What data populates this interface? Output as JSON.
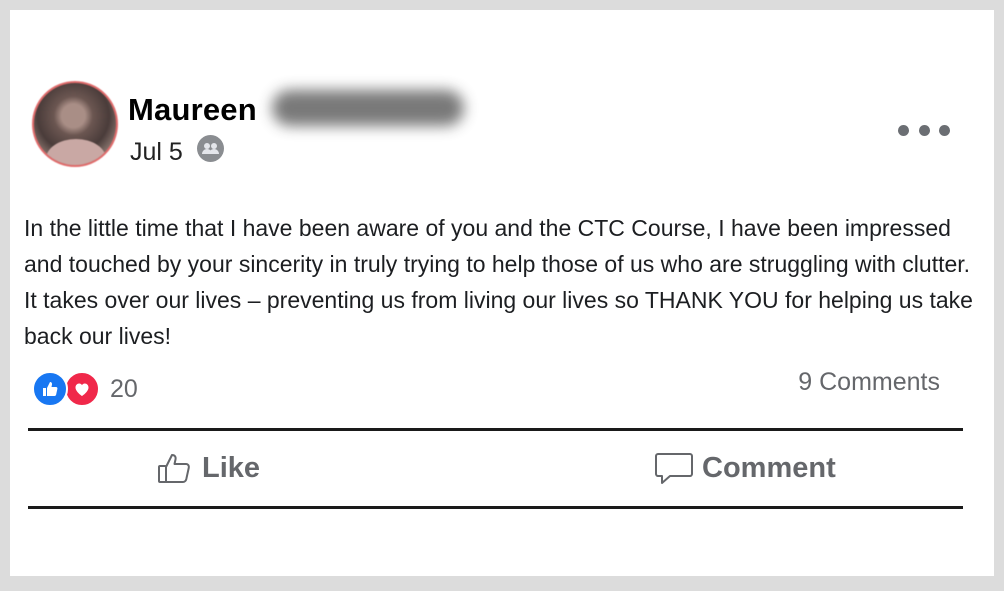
{
  "post": {
    "author_first_name": "Maureen",
    "date": "Jul 5",
    "audience_icon": "friends-icon",
    "body": "In the little time that I have been aware of you and the CTC Course, I have been impressed and touched by your sincerity in truly trying to help those of us who are struggling with clutter. It takes over our lives – preventing us from living our lives so THANK YOU for helping us take back our lives!"
  },
  "reactions": {
    "types": [
      "like-icon",
      "love-icon"
    ],
    "count": "20"
  },
  "comments": {
    "count_label": "9 Comments"
  },
  "actions": {
    "like_label": "Like",
    "comment_label": "Comment"
  },
  "colors": {
    "like_blue": "#1877f2",
    "love_red": "#f0284a",
    "secondary_text": "#65676b"
  }
}
